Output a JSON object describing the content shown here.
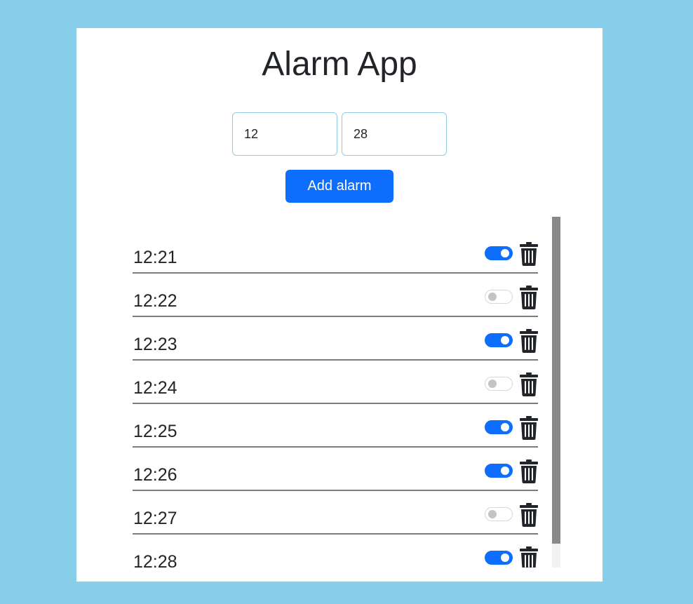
{
  "app": {
    "title": "Alarm App"
  },
  "form": {
    "hour_value": "12",
    "minute_value": "28",
    "add_label": "Add alarm"
  },
  "alarms": [
    {
      "time": "12:21",
      "enabled": true
    },
    {
      "time": "12:22",
      "enabled": false
    },
    {
      "time": "12:23",
      "enabled": true
    },
    {
      "time": "12:24",
      "enabled": false
    },
    {
      "time": "12:25",
      "enabled": true
    },
    {
      "time": "12:26",
      "enabled": true
    },
    {
      "time": "12:27",
      "enabled": false
    },
    {
      "time": "12:28",
      "enabled": true
    }
  ],
  "icons": {
    "delete": "trash-icon"
  },
  "colors": {
    "background": "#87ceeb",
    "accent": "#0d6efd",
    "text": "#212529",
    "toggle_off_knob": "#c4c4c4"
  }
}
